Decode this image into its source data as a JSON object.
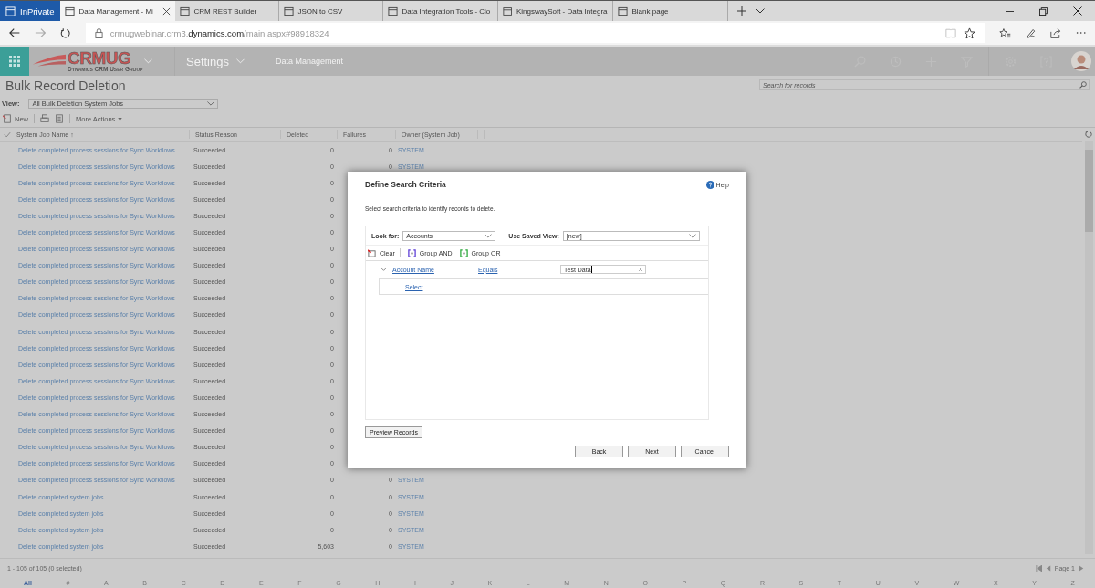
{
  "browser": {
    "private_label": "InPrivate",
    "tabs": [
      {
        "label": "Data Management - Mi",
        "selected": true
      },
      {
        "label": "CRM REST Builder",
        "selected": false
      },
      {
        "label": "JSON to CSV",
        "selected": false
      },
      {
        "label": "Data Integration Tools - Clo",
        "selected": false
      },
      {
        "label": "KingswaySoft - Data Integra",
        "selected": false
      },
      {
        "label": "Blank page",
        "selected": false
      }
    ],
    "address": "crmugwebinar.crm3.**dynamics.com**/main.aspx#98918324"
  },
  "nav": {
    "logo": "CRMUG",
    "tagline": "Dynamics CRM User Group",
    "area": "Settings",
    "breadcrumb": "Data Management"
  },
  "page": {
    "title": "Bulk Record Deletion",
    "search": {
      "placeholder": "Search for records"
    },
    "view_label": "View:",
    "view": "All Bulk Deletion System Jobs",
    "commands": [
      "New",
      "More Actions"
    ]
  },
  "table": {
    "columns": [
      "System Job Name ↑",
      "Status Reason",
      "Deleted",
      "Failures",
      "Owner (System Job)"
    ],
    "rows": [
      {
        "name": "Delete completed process sessions for Sync Workflows",
        "status": "Succeeded",
        "deleted": "0",
        "failures": "0",
        "owner": "SYSTEM"
      },
      {
        "name": "Delete completed process sessions for Sync Workflows",
        "status": "Succeeded",
        "deleted": "0",
        "failures": "0",
        "owner": "SYSTEM"
      },
      {
        "name": "Delete completed process sessions for Sync Workflows",
        "status": "Succeeded",
        "deleted": "0"
      },
      {
        "name": "Delete completed process sessions for Sync Workflows",
        "status": "Succeeded",
        "deleted": "0"
      },
      {
        "name": "Delete completed process sessions for Sync Workflows",
        "status": "Succeeded",
        "deleted": "0"
      },
      {
        "name": "Delete completed process sessions for Sync Workflows",
        "status": "Succeeded",
        "deleted": "0"
      },
      {
        "name": "Delete completed process sessions for Sync Workflows",
        "status": "Succeeded",
        "deleted": "0"
      },
      {
        "name": "Delete completed process sessions for Sync Workflows",
        "status": "Succeeded",
        "deleted": "0"
      },
      {
        "name": "Delete completed process sessions for Sync Workflows",
        "status": "Succeeded",
        "deleted": "0"
      },
      {
        "name": "Delete completed process sessions for Sync Workflows",
        "status": "Succeeded",
        "deleted": "0"
      },
      {
        "name": "Delete completed process sessions for Sync Workflows",
        "status": "Succeeded",
        "deleted": "0"
      },
      {
        "name": "Delete completed process sessions for Sync Workflows",
        "status": "Succeeded",
        "deleted": "0"
      },
      {
        "name": "Delete completed process sessions for Sync Workflows",
        "status": "Succeeded",
        "deleted": "0"
      },
      {
        "name": "Delete completed process sessions for Sync Workflows",
        "status": "Succeeded",
        "deleted": "0"
      },
      {
        "name": "Delete completed process sessions for Sync Workflows",
        "status": "Succeeded",
        "deleted": "0"
      },
      {
        "name": "Delete completed process sessions for Sync Workflows",
        "status": "Succeeded",
        "deleted": "0"
      },
      {
        "name": "Delete completed process sessions for Sync Workflows",
        "status": "Succeeded",
        "deleted": "0"
      },
      {
        "name": "Delete completed process sessions for Sync Workflows",
        "status": "Succeeded",
        "deleted": "0"
      },
      {
        "name": "Delete completed process sessions for Sync Workflows",
        "status": "Succeeded",
        "deleted": "0"
      },
      {
        "name": "Delete completed process sessions for Sync Workflows",
        "status": "Succeeded",
        "deleted": "0"
      },
      {
        "name": "Delete completed process sessions for Sync Workflows",
        "status": "Succeeded",
        "deleted": "0",
        "failures": "0",
        "owner": "SYSTEM"
      },
      {
        "name": "Delete completed system jobs",
        "status": "Succeeded",
        "deleted": "0",
        "failures": "0",
        "owner": "SYSTEM"
      },
      {
        "name": "Delete completed system jobs",
        "status": "Succeeded",
        "deleted": "0",
        "failures": "0",
        "owner": "SYSTEM"
      },
      {
        "name": "Delete completed system jobs",
        "status": "Succeeded",
        "deleted": "0",
        "failures": "0",
        "owner": "SYSTEM"
      },
      {
        "name": "Delete completed system jobs",
        "status": "Succeeded",
        "deleted": "5,603",
        "failures": "0",
        "owner": "SYSTEM"
      }
    ]
  },
  "footer": {
    "count": "1 - 105 of 105 (0 selected)",
    "page": "Page 1"
  },
  "alphabet": [
    {
      "label": "All",
      "selected": true
    },
    {
      "label": "#",
      "selected": false
    },
    {
      "label": "A",
      "selected": false
    },
    {
      "label": "B",
      "selected": false
    },
    {
      "label": "C",
      "selected": false
    },
    {
      "label": "D",
      "selected": false
    },
    {
      "label": "E",
      "selected": false
    },
    {
      "label": "F",
      "selected": false
    },
    {
      "label": "G",
      "selected": false
    },
    {
      "label": "H",
      "selected": false
    },
    {
      "label": "I",
      "selected": false
    },
    {
      "label": "J",
      "selected": false
    },
    {
      "label": "K",
      "selected": false
    },
    {
      "label": "L",
      "selected": false
    },
    {
      "label": "M",
      "selected": false
    },
    {
      "label": "N",
      "selected": false
    },
    {
      "label": "O",
      "selected": false
    },
    {
      "label": "P",
      "selected": false
    },
    {
      "label": "Q",
      "selected": false
    },
    {
      "label": "R",
      "selected": false
    },
    {
      "label": "S",
      "selected": false
    },
    {
      "label": "T",
      "selected": false
    },
    {
      "label": "U",
      "selected": false
    },
    {
      "label": "V",
      "selected": false
    },
    {
      "label": "W",
      "selected": false
    },
    {
      "label": "X",
      "selected": false
    },
    {
      "label": "Y",
      "selected": false
    },
    {
      "label": "Z",
      "selected": false
    }
  ],
  "dialog": {
    "title": "Define Search Criteria",
    "help": "Help",
    "description": "Select search criteria to identify records to delete.",
    "look_for": {
      "label": "Look for:",
      "value": "Accounts"
    },
    "saved_view": {
      "label": "Use Saved View:",
      "value": "[new]"
    },
    "toolbar": [
      {
        "kind": "clear",
        "label": "Clear"
      },
      {
        "kind": "and",
        "label": "Group AND"
      },
      {
        "kind": "or",
        "label": "Group OR"
      }
    ],
    "condition": {
      "field": "Account Name",
      "operator": "Equals",
      "value": "Test Data"
    },
    "select": "Select",
    "preview": "Preview Records",
    "buttons": [
      "Back",
      "Next",
      "Cancel"
    ]
  }
}
